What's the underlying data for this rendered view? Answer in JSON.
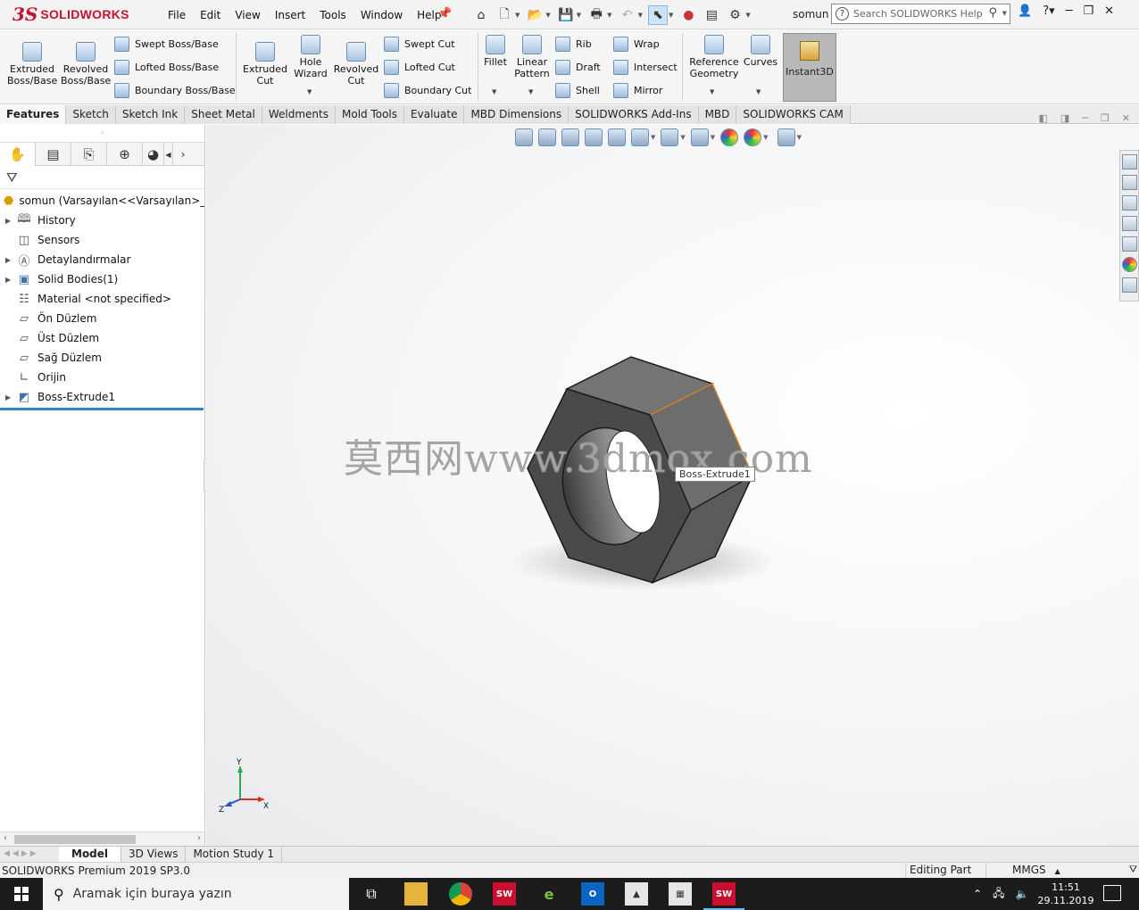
{
  "app": {
    "logo_ds": "3S",
    "logo_text": "SOLIDWORKS",
    "menu": [
      "File",
      "Edit",
      "View",
      "Insert",
      "Tools",
      "Window",
      "Help"
    ],
    "doc_name": "somun",
    "search_placeholder": "Search SOLIDWORKS Help",
    "brand_color": "#c8102e"
  },
  "ribbon": {
    "extruded_boss": "Extruded\nBoss/Base",
    "revolved_boss": "Revolved\nBoss/Base",
    "swept_boss": "Swept Boss/Base",
    "lofted_boss": "Lofted Boss/Base",
    "boundary_boss": "Boundary Boss/Base",
    "extruded_cut": "Extruded\nCut",
    "hole_wizard": "Hole\nWizard",
    "revolved_cut": "Revolved\nCut",
    "swept_cut": "Swept Cut",
    "lofted_cut": "Lofted Cut",
    "boundary_cut": "Boundary Cut",
    "fillet": "Fillet",
    "linear_pattern": "Linear\nPattern",
    "rib": "Rib",
    "draft": "Draft",
    "shell": "Shell",
    "wrap": "Wrap",
    "intersect": "Intersect",
    "mirror": "Mirror",
    "reference_geometry": "Reference\nGeometry",
    "curves": "Curves",
    "instant3d": "Instant3D"
  },
  "tabs": [
    "Features",
    "Sketch",
    "Sketch Ink",
    "Sheet Metal",
    "Weldments",
    "Mold Tools",
    "Evaluate",
    "MBD Dimensions",
    "SOLIDWORKS Add-Ins",
    "MBD",
    "SOLIDWORKS CAM"
  ],
  "tree": {
    "root": "somun  (Varsayılan<<Varsayılan>_Gör",
    "items": [
      {
        "label": "History",
        "icon": "history-icon",
        "expandable": true
      },
      {
        "label": "Sensors",
        "icon": "sensors-icon",
        "expandable": false
      },
      {
        "label": "Detaylandırmalar",
        "icon": "annotations-icon",
        "expandable": true
      },
      {
        "label": "Solid Bodies(1)",
        "icon": "solid-bodies-icon",
        "expandable": true
      },
      {
        "label": "Material <not specified>",
        "icon": "material-icon",
        "expandable": false
      },
      {
        "label": "Ön Düzlem",
        "icon": "plane-icon",
        "expandable": false
      },
      {
        "label": "Üst Düzlem",
        "icon": "plane-icon",
        "expandable": false
      },
      {
        "label": "Sağ Düzlem",
        "icon": "plane-icon",
        "expandable": false
      },
      {
        "label": "Orijin",
        "icon": "origin-icon",
        "expandable": false
      },
      {
        "label": "Boss-Extrude1",
        "icon": "extrude-feature-icon",
        "expandable": true
      }
    ]
  },
  "viewport": {
    "watermark": "莫西网www.3dmox.com",
    "tooltip": "Boss-Extrude1",
    "triad_x": "X",
    "triad_y": "Y",
    "triad_z": "Z"
  },
  "bottom_tabs": [
    "Model",
    "3D Views",
    "Motion Study 1"
  ],
  "status": {
    "version": "SOLIDWORKS Premium 2019 SP3.0",
    "mode": "Editing Part",
    "units": "MMGS"
  },
  "taskbar": {
    "search_placeholder": "Aramak için buraya yazın",
    "time": "11:51",
    "date": "29.11.2019"
  }
}
